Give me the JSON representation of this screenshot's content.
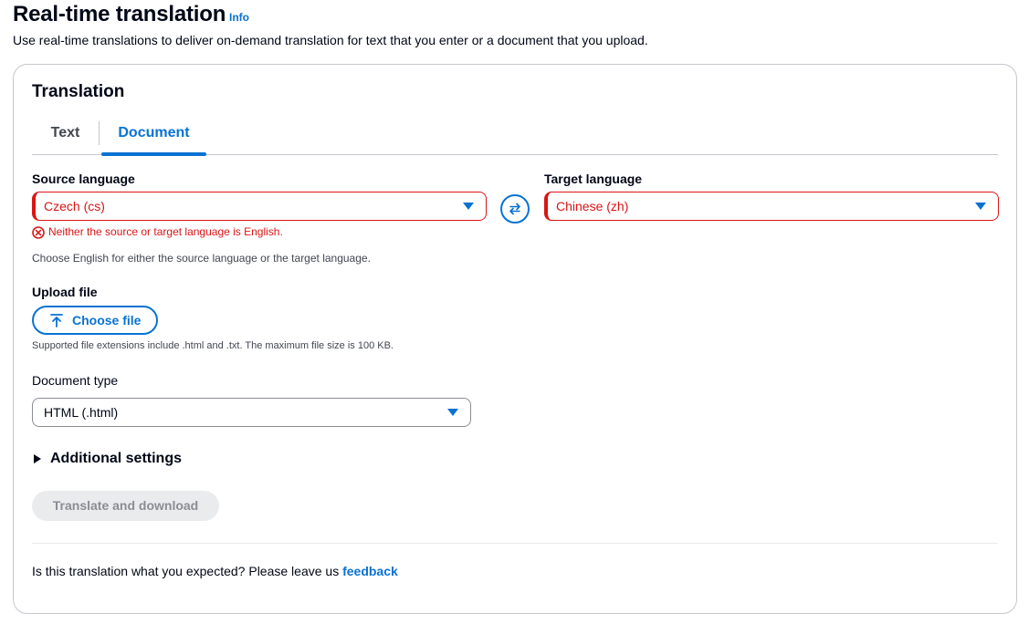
{
  "header": {
    "title": "Real-time translation",
    "info_link": "Info",
    "description": "Use real-time translations to deliver on-demand translation for text that you enter or a document that you upload."
  },
  "card": {
    "title": "Translation",
    "tabs": [
      {
        "label": "Text",
        "active": false
      },
      {
        "label": "Document",
        "active": true
      }
    ]
  },
  "form": {
    "source_language": {
      "label": "Source language",
      "value": "Czech (cs)"
    },
    "target_language": {
      "label": "Target language",
      "value": "Chinese (zh)"
    },
    "error_text": "Neither the source or target language is English.",
    "language_hint": "Choose English for either the source language or the target language.",
    "upload": {
      "label": "Upload file",
      "button_label": "Choose file",
      "hint": "Supported file extensions include .html and .txt. The maximum file size is 100 KB."
    },
    "document_type": {
      "label": "Document type",
      "value": "HTML (.html)"
    },
    "additional_settings_label": "Additional settings",
    "translate_button_label": "Translate and download"
  },
  "footer": {
    "feedback_prompt": "Is this translation what you expected? Please leave us",
    "feedback_link": "feedback"
  },
  "colors": {
    "accent": "#0972d3",
    "error": "#d91515",
    "border": "#c6c6cd",
    "disabled_bg": "#e9ebed",
    "disabled_text": "#8c8c94"
  },
  "icons": [
    "error-icon",
    "swap-icon",
    "upload-icon",
    "caret-down-icon",
    "caret-right-icon"
  ]
}
